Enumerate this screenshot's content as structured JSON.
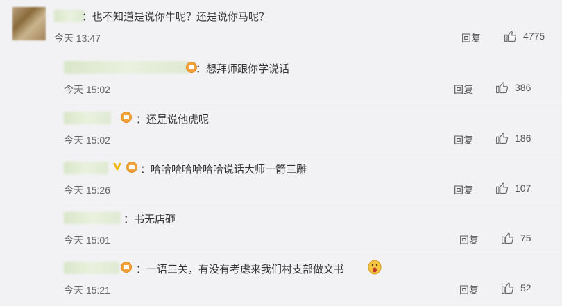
{
  "colors": {
    "background": "#f2f2f4",
    "text": "#333333",
    "meta": "#666666",
    "badge": "#f3a23a",
    "vip": "#f2b705"
  },
  "main_comment": {
    "text": "：也不知道是说你牛呢？还是说你马呢？",
    "time": "今天 13:47",
    "reply_label": "回复",
    "likes": "4775",
    "icons": [
      "like-icon"
    ]
  },
  "replies": [
    {
      "text": "：想拜师跟你学说话",
      "time": "今天 15:02",
      "reply_label": "回复",
      "likes": "386"
    },
    {
      "text": "：还是说他虎呢",
      "time": "今天 15:02",
      "reply_label": "回复",
      "likes": "186"
    },
    {
      "text": "：哈哈哈哈哈哈哈说话大师一箭三雕",
      "time": "今天 15:26",
      "reply_label": "回复",
      "likes": "107"
    },
    {
      "text": "：书无店砸",
      "time": "今天 15:01",
      "reply_label": "回复",
      "likes": "75"
    },
    {
      "text": "：一语三关，有没有考虑来我们村支部做文书",
      "time": "今天 15:21",
      "reply_label": "回复",
      "likes": "52"
    }
  ]
}
